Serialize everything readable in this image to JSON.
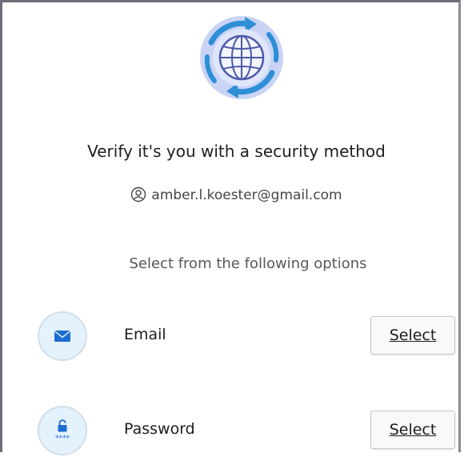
{
  "header": {
    "logo_icon": "globe-sync-icon",
    "title": "Verify it's you with a security method"
  },
  "account": {
    "icon": "user-circle-icon",
    "email": "amber.l.koester@gmail.com"
  },
  "options_intro": "Select from the following options",
  "options": [
    {
      "label": "Email",
      "icon": "envelope-icon",
      "action": "Select"
    },
    {
      "label": "Password",
      "icon": "password-lock-icon",
      "action": "Select"
    }
  ],
  "colors": {
    "accent_blue": "#1d6dd1",
    "badge_bg": "#e3f2fd",
    "globe_ring": "#b9c5ef",
    "globe_stroke": "#4c5aa8"
  }
}
